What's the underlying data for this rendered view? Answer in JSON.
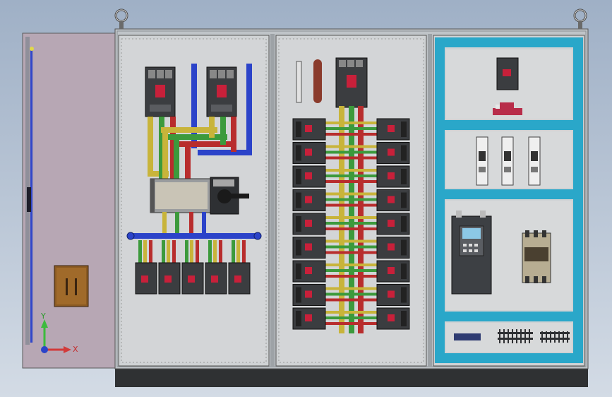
{
  "viewport": {
    "background_top": "#9fb0c6",
    "background_bottom": "#d3dbe5"
  },
  "colors": {
    "cabinet_frame": "#bfc4c8",
    "panel": "#cfd2d4",
    "door": "#b7a7b4",
    "busbar_blue": "#2b43c9",
    "busbar_green": "#3c9a3c",
    "busbar_yellow": "#c8b43a",
    "busbar_red": "#b82d2d",
    "din_rail_teal": "#2aa7c9",
    "breaker_dark": "#3b3d40",
    "plinth": "#2f3133"
  },
  "icons": {
    "lifting_eye_left": "lifting-eye-icon",
    "lifting_eye_right": "lifting-eye-icon",
    "triad": "coordinate-triad-icon"
  },
  "triad": {
    "x_label": "X",
    "y_label": "Y"
  }
}
